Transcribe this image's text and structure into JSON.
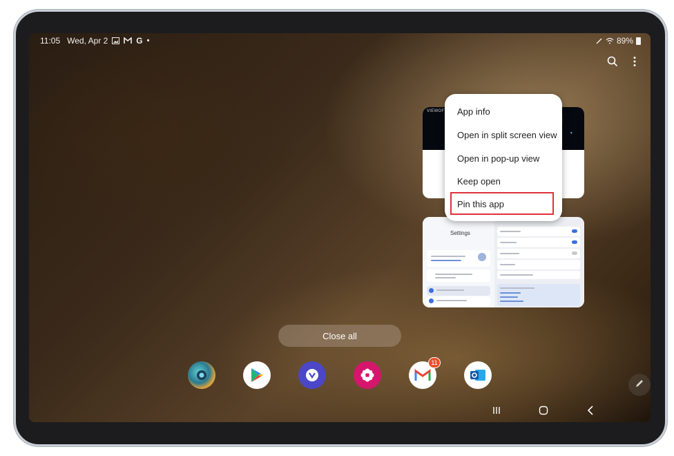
{
  "status_bar": {
    "time": "11:05",
    "date": "Wed, Apr 2",
    "notif_icons": [
      "image-icon",
      "gmail-icon",
      "google-icon",
      "dot-icon"
    ],
    "battery": "89%"
  },
  "recent_apps": {
    "card_top_label": "VIEWOFTHE",
    "settings_card": {
      "title": "Settings"
    }
  },
  "context_menu": {
    "items": [
      "App info",
      "Open in split screen view",
      "Open in pop-up view",
      "Keep open",
      "Pin this app"
    ],
    "highlighted": "Pin this app",
    "highlight_color": "#e0313b"
  },
  "close_all": "Close all",
  "dock": {
    "apps": [
      {
        "name": "camera-app"
      },
      {
        "name": "play-store"
      },
      {
        "name": "galaxy-app"
      },
      {
        "name": "flower-app"
      },
      {
        "name": "gmail",
        "badge": "11"
      },
      {
        "name": "outlook"
      }
    ]
  },
  "colors": {
    "accent": "#3b6fe0",
    "badge": "#e8512b"
  }
}
